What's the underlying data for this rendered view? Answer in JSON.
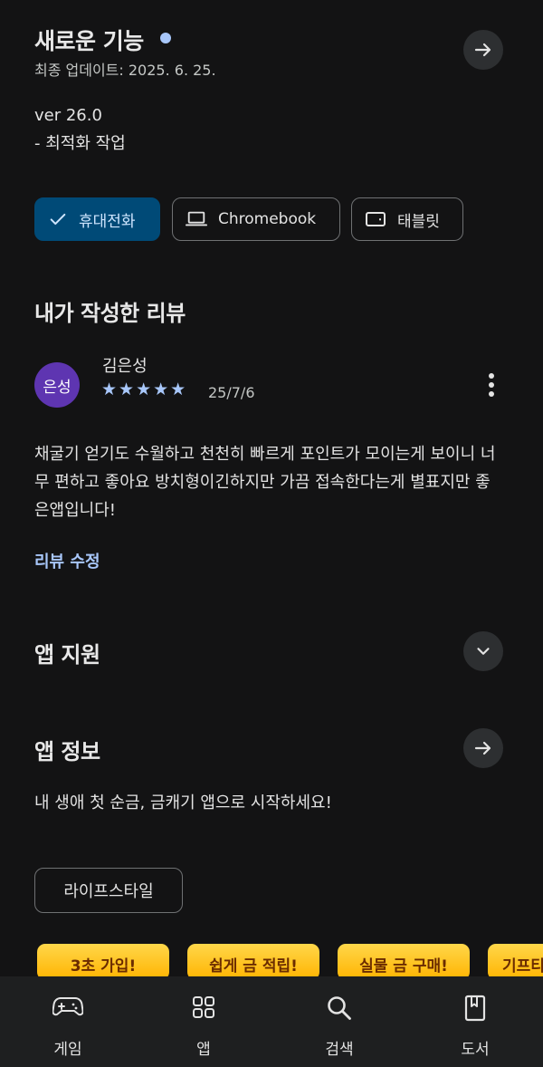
{
  "whats_new": {
    "title": "새로운 기능",
    "last_updated": "최종 업데이트: 2025. 6. 25.",
    "version": "ver 26.0",
    "notes": "- 최적화 작업"
  },
  "devices": {
    "chips": [
      {
        "label": "휴대전화",
        "icon": "check-icon",
        "selected": true
      },
      {
        "label": "Chromebook",
        "icon": "laptop-icon",
        "selected": false
      },
      {
        "label": "태블릿",
        "icon": "tablet-icon",
        "selected": false
      }
    ]
  },
  "my_review": {
    "heading": "내가 작성한 리뷰",
    "avatar_text": "은성",
    "author": "김은성",
    "stars": "★★★★★",
    "rating": 5,
    "date": "25/7/6",
    "text": "채굴기 얻기도 수월하고 천천히 빠르게 포인트가 모이는게 보이니 너무 편하고 좋아요 방치형이긴하지만 가끔 접속한다는게 별표지만 좋은앱입니다!",
    "edit_link": "리뷰 수정"
  },
  "app_support": {
    "heading": "앱 지원"
  },
  "app_info": {
    "heading": "앱 정보",
    "description": "내 생애 첫 순금, 금캐기 앱으로 시작하세요!",
    "category_tag": "라이프스타일"
  },
  "banners": [
    "3초 가입!",
    "쉽게 금 적립!",
    "실물 금 구매!",
    "기프티"
  ],
  "bottom_nav": [
    {
      "label": "게임",
      "icon": "gamepad-icon"
    },
    {
      "label": "앱",
      "icon": "apps-grid-icon"
    },
    {
      "label": "검색",
      "icon": "search-icon"
    },
    {
      "label": "도서",
      "icon": "book-icon"
    }
  ],
  "colors": {
    "background": "#131314",
    "accent": "#a8c7fa",
    "selected_chip": "#004a77",
    "avatar": "#5e35b1",
    "banner": "#ffc107"
  }
}
